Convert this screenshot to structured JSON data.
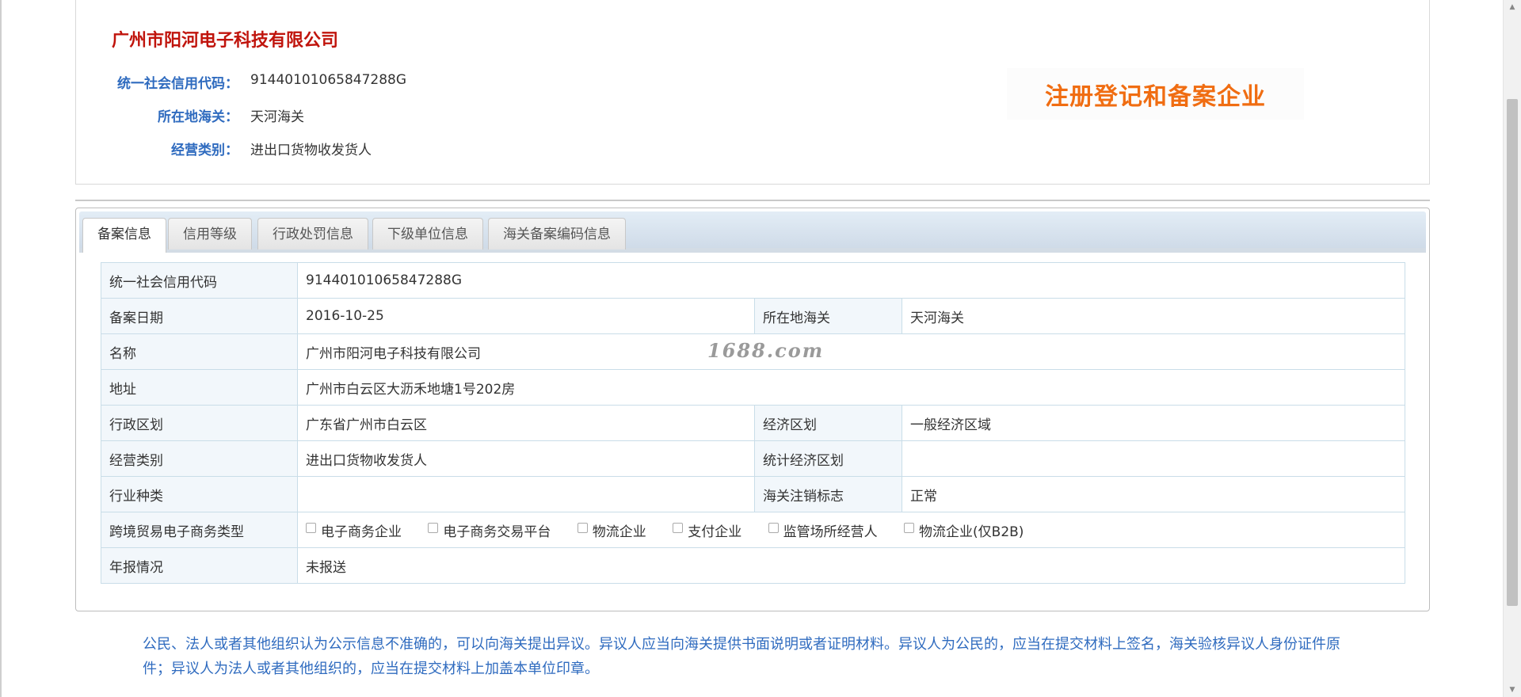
{
  "company": {
    "name": "广州市阳河电子科技有限公司",
    "credit_code_label": "统一社会信用代码：",
    "credit_code": "91440101065847288G",
    "customs_label": "所在地海关：",
    "customs": "天河海关",
    "business_type_label": "经营类别：",
    "business_type": "进出口货物收发货人",
    "stamp_text": "注册登记和备案企业"
  },
  "tabs": [
    "备案信息",
    "信用等级",
    "行政处罚信息",
    "下级单位信息",
    "海关备案编码信息"
  ],
  "table": {
    "r1": {
      "label": "统一社会信用代码",
      "value": "91440101065847288G"
    },
    "r2": {
      "label": "备案日期",
      "value": "2016-10-25",
      "label2": "所在地海关",
      "value2": "天河海关"
    },
    "r3": {
      "label": "名称",
      "value": "广州市阳河电子科技有限公司"
    },
    "r4": {
      "label": "地址",
      "value": "广州市白云区大沥禾地塘1号202房"
    },
    "r5": {
      "label": "行政区划",
      "value": "广东省广州市白云区",
      "label2": "经济区划",
      "value2": "一般经济区域"
    },
    "r6": {
      "label": "经营类别",
      "value": "进出口货物收发货人",
      "label2": "统计经济区划",
      "value2": ""
    },
    "r7": {
      "label": "行业种类",
      "value": "",
      "label2": "海关注销标志",
      "value2": "正常"
    },
    "r8": {
      "label": "跨境贸易电子商务类型",
      "options": [
        "电子商务企业",
        "电子商务交易平台",
        "物流企业",
        "支付企业",
        "监管场所经营人",
        "物流企业(仅B2B)"
      ]
    },
    "r9": {
      "label": "年报情况",
      "value": "未报送"
    }
  },
  "watermark": "1688.com",
  "notice": "公民、法人或者其他组织认为公示信息不准确的，可以向海关提出异议。异议人应当向海关提供书面说明或者证明材料。异议人为公民的，应当在提交材料上签名，海关验核异议人身份证件原件；异议人为法人或者其他组织的，应当在提交材料上加盖本单位印章。"
}
